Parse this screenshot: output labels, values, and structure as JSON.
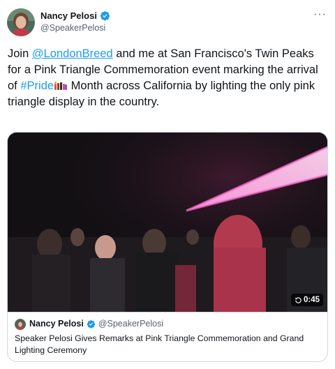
{
  "author": {
    "name": "Nancy Pelosi",
    "handle": "@SpeakerPelosi"
  },
  "more_icon": "more-options-icon",
  "tweet": {
    "text_pre": "Join ",
    "mention": "@LondonBreed",
    "text_mid": " and me at San Francisco's Twin Peaks for a Pink Triangle Commemoration event marking the arrival of ",
    "hashtag": "#Pride",
    "text_post": " Month across California by lighting the only pink triangle display in the country."
  },
  "video": {
    "duration": "0:45"
  },
  "quoted": {
    "name": "Nancy Pelosi",
    "handle": "@SpeakerPelosi",
    "text": "Speaker Pelosi Gives Remarks at Pink Triangle Commemoration and Grand Lighting Ceremony"
  },
  "colors": {
    "link": "#1d9bf0",
    "verified": "#1d9bf0",
    "pink_light": "#ff6fd0"
  }
}
